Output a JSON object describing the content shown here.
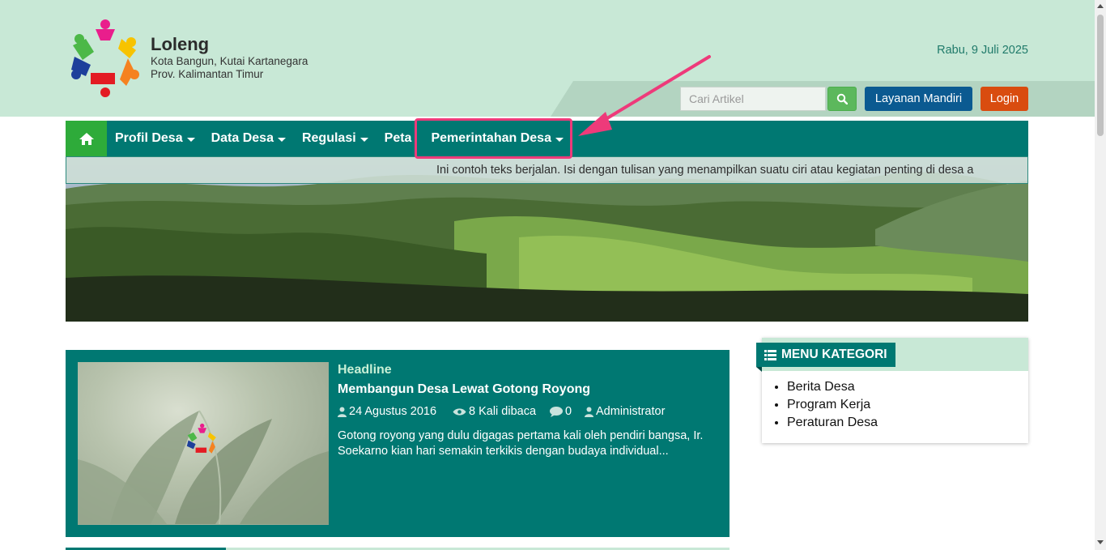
{
  "site": {
    "name": "Loleng",
    "subtitle_line1": "Kota Bangun, Kutai Kartanegara",
    "subtitle_line2": "Prov. Kalimantan Timur",
    "date": "Rabu, 9 Juli 2025"
  },
  "search": {
    "placeholder": "Cari Artikel",
    "icon": "search-icon"
  },
  "buttons": {
    "layanan": "Layanan Mandiri",
    "login": "Login"
  },
  "nav": {
    "home_icon": "home-icon",
    "items": [
      {
        "label": "Profil Desa",
        "dropdown": true
      },
      {
        "label": "Data Desa",
        "dropdown": true
      },
      {
        "label": "Regulasi",
        "dropdown": true
      },
      {
        "label": "Peta",
        "dropdown": false
      },
      {
        "label": "Pemerintahan Desa",
        "dropdown": true
      }
    ]
  },
  "ticker": {
    "text": "Ini contoh teks berjalan. Isi dengan tulisan yang menampilkan suatu ciri atau kegiatan penting di desa a"
  },
  "headline": {
    "label": "Headline",
    "title": "Membangun Desa Lewat Gotong Royong",
    "date": "24 Agustus 2016",
    "views": "8 Kali dibaca",
    "comments": "0",
    "author": "Administrator",
    "excerpt": "Gotong royong yang dulu digagas pertama kali oleh pendiri bangsa, Ir. Soekarno kian hari semakin terkikis dengan budaya individual..."
  },
  "sidebar": {
    "title": "MENU KATEGORI",
    "categories": [
      "Berita Desa",
      "Program Kerja",
      "Peraturan Desa"
    ]
  },
  "colors": {
    "header_bg": "#c8e8d6",
    "nav_bg": "#007872",
    "home_bg": "#2eab3a",
    "login_bg": "#d94c0f",
    "layanan_bg": "#0b5a91",
    "highlight": "#ee3a7a"
  }
}
